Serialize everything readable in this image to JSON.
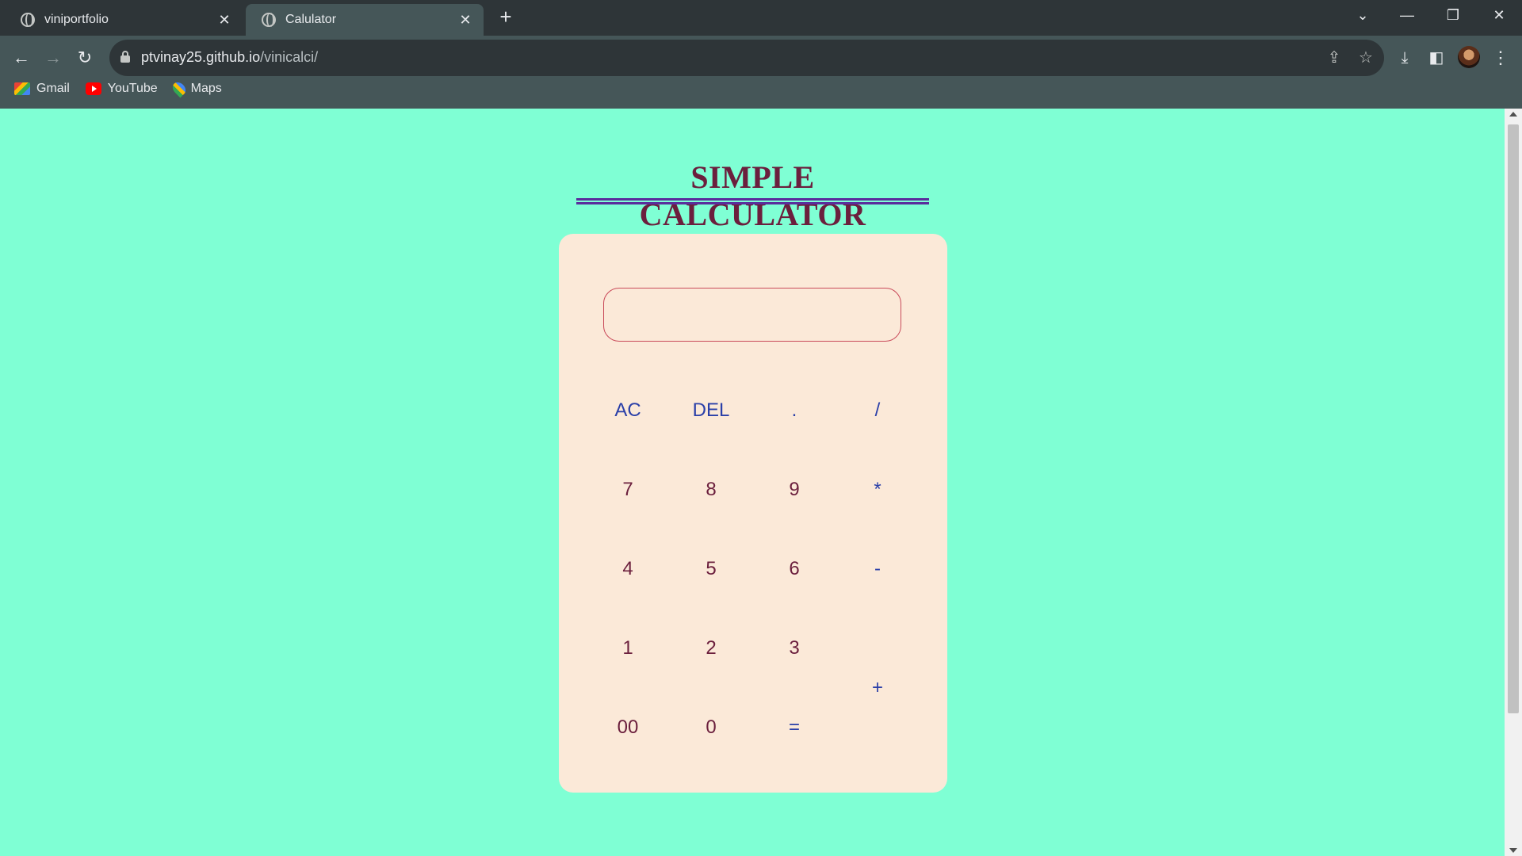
{
  "browser": {
    "tabs": [
      {
        "title": "viniportfolio",
        "active": false
      },
      {
        "title": "Calulator",
        "active": true
      }
    ],
    "new_tab_label": "+",
    "url_host": "ptvinay25.github.io",
    "url_path": "/vinicalci/",
    "bookmarks": [
      {
        "label": "Gmail",
        "icon": "gmail-icon"
      },
      {
        "label": "YouTube",
        "icon": "youtube-icon"
      },
      {
        "label": "Maps",
        "icon": "maps-icon"
      }
    ]
  },
  "page": {
    "title": "SIMPLE CALCULATOR",
    "display_value": "",
    "keys": {
      "ac": "AC",
      "del": "DEL",
      "dot": ".",
      "divide": "/",
      "seven": "7",
      "eight": "8",
      "nine": "9",
      "multiply": "*",
      "four": "4",
      "five": "5",
      "six": "6",
      "minus": "-",
      "one": "1",
      "two": "2",
      "three": "3",
      "plus": "+",
      "double_zero": "00",
      "zero": "0",
      "equals": "="
    }
  },
  "colors": {
    "page_bg": "#7fffd4",
    "calc_bg": "#fbe9d8",
    "number_key": "#6b1f3d",
    "operator_key": "#2a3fa8",
    "heading": "#6b1f3d",
    "heading_underline": "#5a2d9c",
    "display_border": "#c94a5a"
  }
}
